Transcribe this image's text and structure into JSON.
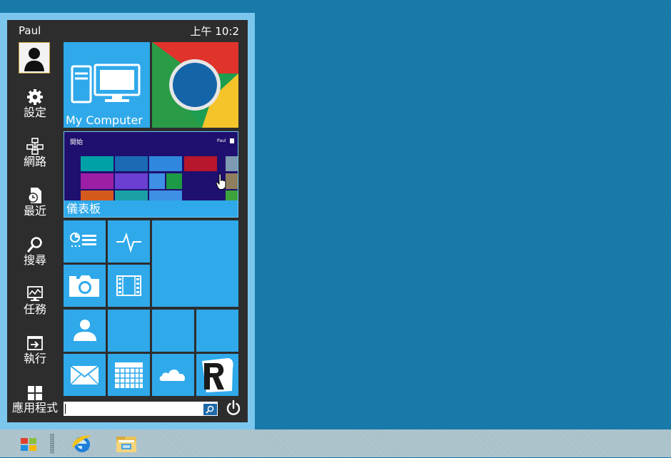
{
  "start_menu": {
    "user": "Paul",
    "clock": "上午 10:2",
    "sidebar": [
      {
        "id": "settings",
        "label": "設定",
        "icon": "gear-icon"
      },
      {
        "id": "network",
        "label": "網路",
        "icon": "network-icon"
      },
      {
        "id": "recent",
        "label": "最近",
        "icon": "recent-documents-icon"
      },
      {
        "id": "search",
        "label": "搜尋",
        "icon": "search-icon"
      },
      {
        "id": "tasks",
        "label": "任務",
        "icon": "task-monitor-icon"
      },
      {
        "id": "run",
        "label": "執行",
        "icon": "run-icon"
      },
      {
        "id": "apps",
        "label": "應用程式",
        "icon": "apps-grid-icon"
      }
    ],
    "tiles": {
      "my_computer": "My Computer",
      "chrome": "Google Chrome",
      "dashboard": "儀表板",
      "dashboard_preview_title": "開始",
      "dashboard_preview_user": "Paul"
    },
    "search": {
      "value": "",
      "placeholder": ""
    }
  },
  "colors": {
    "desktop": "#1779a8",
    "tile": "#2fa9ea",
    "menu_bg": "#2d2d2d",
    "frame": "#7cc6ee",
    "taskbar": "#a7bfc9"
  },
  "taskbar": {
    "items": [
      "start-button",
      "internet-explorer-icon",
      "file-explorer-icon"
    ]
  }
}
